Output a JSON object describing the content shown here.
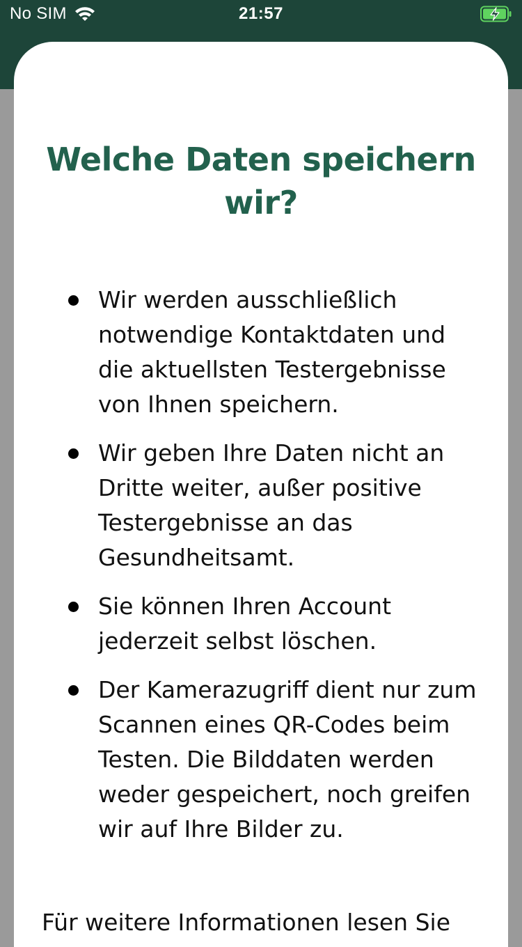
{
  "status_bar": {
    "carrier": "No SIM",
    "time": "21:57",
    "icons": [
      "wifi-icon",
      "battery-charging-icon"
    ]
  },
  "colors": {
    "header_background": "#1d4539",
    "title": "#22614d",
    "backdrop": "#9a9a9a",
    "sheet": "#ffffff",
    "battery": "#5fd35f"
  },
  "modal": {
    "title": "Welche Daten speichern wir?",
    "bullets": [
      "Wir werden ausschließlich notwendige Kontaktdaten und die aktuellsten Testergebnisse von Ihnen speichern.",
      "Wir geben Ihre Daten nicht an Dritte weiter, außer positive Testergebnisse an das Gesundheitsamt.",
      "Sie können Ihren Account jederzeit selbst löschen.",
      "Der Kamerazugriff dient nur zum Scannen eines QR-Codes beim Testen. Die Bilddaten werden weder gespeichert, noch greifen wir auf Ihre Bilder zu."
    ],
    "footer": "Für weitere Informationen lesen Sie"
  }
}
